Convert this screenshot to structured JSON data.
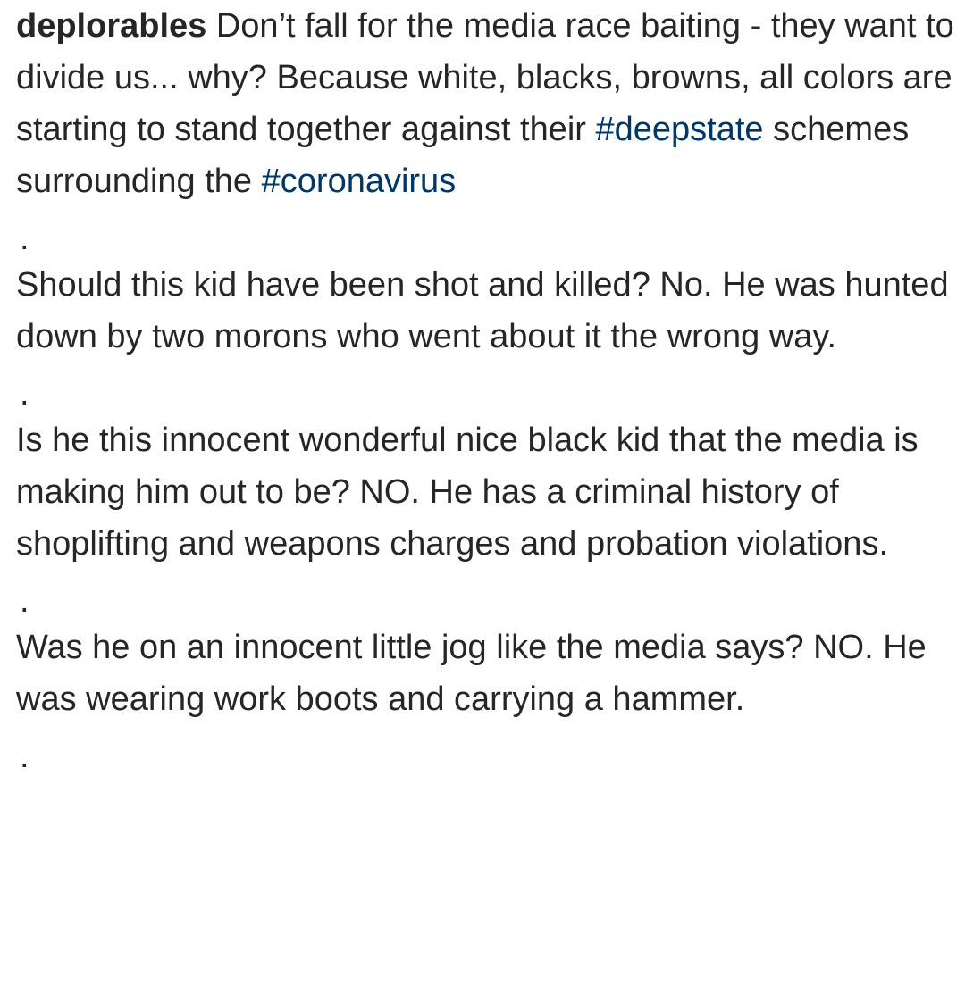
{
  "post": {
    "username": "deplorables",
    "intro_text": "Don’t fall for the media race baiting - they want to divide us... why? Because white, blacks, browns, all colors are starting to stand together against their",
    "hashtag_1": "#deepstate",
    "mid_text": "schemes surrounding the",
    "hashtag_2": "#coronavirus",
    "separator": ".",
    "paragraph_2": "Should this kid have been shot and killed? No. He was hunted down by two morons who went about it the wrong way.",
    "paragraph_3": "Is he this innocent wonderful nice black kid that the media is making him out to be? NO. He has a criminal history of shoplifting and weapons charges and probation violations.",
    "paragraph_4": "Was he on an innocent little jog like the media says? NO. He was wearing work boots and carrying a hammer."
  },
  "colors": {
    "text": "#262626",
    "hashtag": "#00376b",
    "background": "#ffffff"
  }
}
